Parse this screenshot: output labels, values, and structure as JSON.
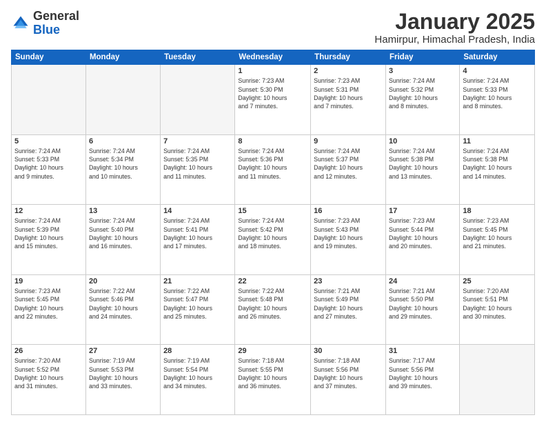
{
  "header": {
    "logo_general": "General",
    "logo_blue": "Blue",
    "month": "January 2025",
    "location": "Hamirpur, Himachal Pradesh, India"
  },
  "days_of_week": [
    "Sunday",
    "Monday",
    "Tuesday",
    "Wednesday",
    "Thursday",
    "Friday",
    "Saturday"
  ],
  "weeks": [
    [
      {
        "day": "",
        "info": ""
      },
      {
        "day": "",
        "info": ""
      },
      {
        "day": "",
        "info": ""
      },
      {
        "day": "1",
        "info": "Sunrise: 7:23 AM\nSunset: 5:30 PM\nDaylight: 10 hours\nand 7 minutes."
      },
      {
        "day": "2",
        "info": "Sunrise: 7:23 AM\nSunset: 5:31 PM\nDaylight: 10 hours\nand 7 minutes."
      },
      {
        "day": "3",
        "info": "Sunrise: 7:24 AM\nSunset: 5:32 PM\nDaylight: 10 hours\nand 8 minutes."
      },
      {
        "day": "4",
        "info": "Sunrise: 7:24 AM\nSunset: 5:33 PM\nDaylight: 10 hours\nand 8 minutes."
      }
    ],
    [
      {
        "day": "5",
        "info": "Sunrise: 7:24 AM\nSunset: 5:33 PM\nDaylight: 10 hours\nand 9 minutes."
      },
      {
        "day": "6",
        "info": "Sunrise: 7:24 AM\nSunset: 5:34 PM\nDaylight: 10 hours\nand 10 minutes."
      },
      {
        "day": "7",
        "info": "Sunrise: 7:24 AM\nSunset: 5:35 PM\nDaylight: 10 hours\nand 11 minutes."
      },
      {
        "day": "8",
        "info": "Sunrise: 7:24 AM\nSunset: 5:36 PM\nDaylight: 10 hours\nand 11 minutes."
      },
      {
        "day": "9",
        "info": "Sunrise: 7:24 AM\nSunset: 5:37 PM\nDaylight: 10 hours\nand 12 minutes."
      },
      {
        "day": "10",
        "info": "Sunrise: 7:24 AM\nSunset: 5:38 PM\nDaylight: 10 hours\nand 13 minutes."
      },
      {
        "day": "11",
        "info": "Sunrise: 7:24 AM\nSunset: 5:38 PM\nDaylight: 10 hours\nand 14 minutes."
      }
    ],
    [
      {
        "day": "12",
        "info": "Sunrise: 7:24 AM\nSunset: 5:39 PM\nDaylight: 10 hours\nand 15 minutes."
      },
      {
        "day": "13",
        "info": "Sunrise: 7:24 AM\nSunset: 5:40 PM\nDaylight: 10 hours\nand 16 minutes."
      },
      {
        "day": "14",
        "info": "Sunrise: 7:24 AM\nSunset: 5:41 PM\nDaylight: 10 hours\nand 17 minutes."
      },
      {
        "day": "15",
        "info": "Sunrise: 7:24 AM\nSunset: 5:42 PM\nDaylight: 10 hours\nand 18 minutes."
      },
      {
        "day": "16",
        "info": "Sunrise: 7:23 AM\nSunset: 5:43 PM\nDaylight: 10 hours\nand 19 minutes."
      },
      {
        "day": "17",
        "info": "Sunrise: 7:23 AM\nSunset: 5:44 PM\nDaylight: 10 hours\nand 20 minutes."
      },
      {
        "day": "18",
        "info": "Sunrise: 7:23 AM\nSunset: 5:45 PM\nDaylight: 10 hours\nand 21 minutes."
      }
    ],
    [
      {
        "day": "19",
        "info": "Sunrise: 7:23 AM\nSunset: 5:45 PM\nDaylight: 10 hours\nand 22 minutes."
      },
      {
        "day": "20",
        "info": "Sunrise: 7:22 AM\nSunset: 5:46 PM\nDaylight: 10 hours\nand 24 minutes."
      },
      {
        "day": "21",
        "info": "Sunrise: 7:22 AM\nSunset: 5:47 PM\nDaylight: 10 hours\nand 25 minutes."
      },
      {
        "day": "22",
        "info": "Sunrise: 7:22 AM\nSunset: 5:48 PM\nDaylight: 10 hours\nand 26 minutes."
      },
      {
        "day": "23",
        "info": "Sunrise: 7:21 AM\nSunset: 5:49 PM\nDaylight: 10 hours\nand 27 minutes."
      },
      {
        "day": "24",
        "info": "Sunrise: 7:21 AM\nSunset: 5:50 PM\nDaylight: 10 hours\nand 29 minutes."
      },
      {
        "day": "25",
        "info": "Sunrise: 7:20 AM\nSunset: 5:51 PM\nDaylight: 10 hours\nand 30 minutes."
      }
    ],
    [
      {
        "day": "26",
        "info": "Sunrise: 7:20 AM\nSunset: 5:52 PM\nDaylight: 10 hours\nand 31 minutes."
      },
      {
        "day": "27",
        "info": "Sunrise: 7:19 AM\nSunset: 5:53 PM\nDaylight: 10 hours\nand 33 minutes."
      },
      {
        "day": "28",
        "info": "Sunrise: 7:19 AM\nSunset: 5:54 PM\nDaylight: 10 hours\nand 34 minutes."
      },
      {
        "day": "29",
        "info": "Sunrise: 7:18 AM\nSunset: 5:55 PM\nDaylight: 10 hours\nand 36 minutes."
      },
      {
        "day": "30",
        "info": "Sunrise: 7:18 AM\nSunset: 5:56 PM\nDaylight: 10 hours\nand 37 minutes."
      },
      {
        "day": "31",
        "info": "Sunrise: 7:17 AM\nSunset: 5:56 PM\nDaylight: 10 hours\nand 39 minutes."
      },
      {
        "day": "",
        "info": ""
      }
    ]
  ]
}
